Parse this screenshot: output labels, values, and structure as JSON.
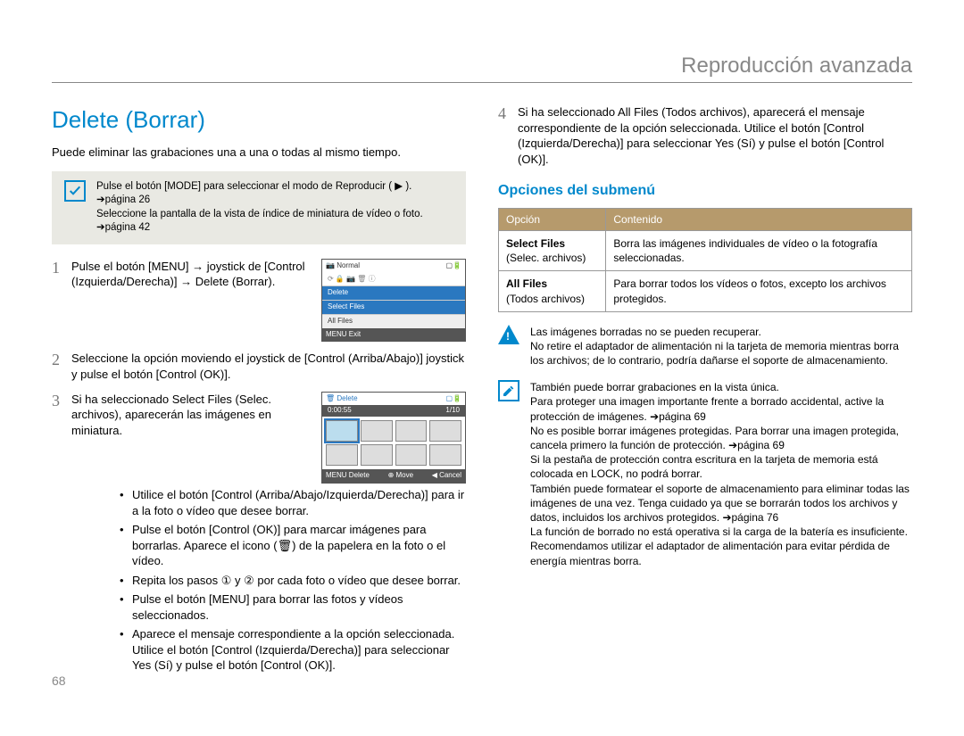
{
  "header": {
    "section": "Reproducción avanzada"
  },
  "page_number": "68",
  "left": {
    "title": "Delete (Borrar)",
    "intro": "Puede eliminar las grabaciones una a una o todas al mismo tiempo.",
    "note_line1": "Pulse el botón [MODE] para seleccionar el modo de Reproducir ( ▶ ). ➔página 26",
    "note_line2": "Seleccione la pantalla de la vista de índice de miniatura de vídeo o foto. ➔página 42",
    "step1": "Pulse el botón [MENU] → joystick de [Control (Izquierda/Derecha)] → Delete (Borrar).",
    "step2": "Seleccione la opción moviendo el joystick de [Control (Arriba/Abajo)] joystick y pulse el botón [Control (OK)].",
    "step3_lead": "Si ha seleccionado Select Files (Selec. archivos), aparecerán las imágenes en miniatura.",
    "step3_a": "Utilice el botón [Control (Arriba/Abajo/Izquierda/Derecha)] para ir a la foto o vídeo que desee borrar.",
    "step3_b": "Pulse el botón [Control (OK)] para marcar imágenes para borrarlas. Aparece el icono (🗑) de la papelera en la foto o el vídeo.",
    "step3_c": "Repita los pasos ① y ② por cada foto o vídeo que desee borrar.",
    "step3_d": "Pulse el botón [MENU] para borrar las fotos y vídeos seleccionados.",
    "step3_e": "Aparece el mensaje correspondiente a la opción seleccionada. Utilice el botón [Control (Izquierda/Derecha)] para seleccionar Yes (Sí) y pulse el botón [Control (OK)].",
    "screen1": {
      "mode": "Normal",
      "menu_header": "Delete",
      "item_selected": "Select Files",
      "item_other": "All Files",
      "bottom_menu": "MENU",
      "bottom_exit": "Exit"
    },
    "screen2": {
      "title": "Delete",
      "time": "0:00:55",
      "counter": "1/10",
      "btn_delete": "Delete",
      "btn_move": "Move",
      "btn_cancel": "Cancel",
      "btn_menu": "MENU"
    }
  },
  "right": {
    "step4": "Si ha seleccionado All Files (Todos archivos), aparecerá el mensaje correspondiente de la opción seleccionada. Utilice el botón [Control (Izquierda/Derecha)] para seleccionar Yes (Sí) y pulse el botón [Control (OK)].",
    "subhead": "Opciones del submenú",
    "table_h1": "Opción",
    "table_h2": "Contenido",
    "row1_opt": "Select Files",
    "row1_sub": "(Selec. archivos)",
    "row1_txt": "Borra las imágenes individuales de vídeo o la fotografía seleccionadas.",
    "row2_opt": "All Files",
    "row2_sub": "(Todos archivos)",
    "row2_txt": "Para borrar todos los vídeos o fotos, excepto los archivos protegidos.",
    "warn": "Las imágenes borradas no se pueden recuperar.\nNo retire el adaptador de alimentación ni la tarjeta de memoria mientras borra los archivos; de lo contrario, podría dañarse el soporte de almacenamiento.",
    "info1": "También puede borrar grabaciones en la vista única.",
    "info2": "Para proteger una imagen importante frente a borrado accidental, active la protección de imágenes. ➔página 69",
    "info3": "No es posible borrar imágenes protegidas. Para borrar una imagen protegida, cancela primero la función de protección. ➔página 69",
    "info4": "Si la pestaña de protección contra escritura en la tarjeta de memoria está colocada en LOCK, no podrá borrar.",
    "info5": "También puede formatear el soporte de almacenamiento para eliminar todas las imágenes de una vez. Tenga cuidado ya que se borrarán todos los archivos y datos, incluidos los archivos protegidos. ➔página 76",
    "info6": "La función de borrado no está operativa si la carga de la batería es insuficiente. Recomendamos utilizar el adaptador de alimentación para evitar pérdida de energía mientras borra."
  }
}
